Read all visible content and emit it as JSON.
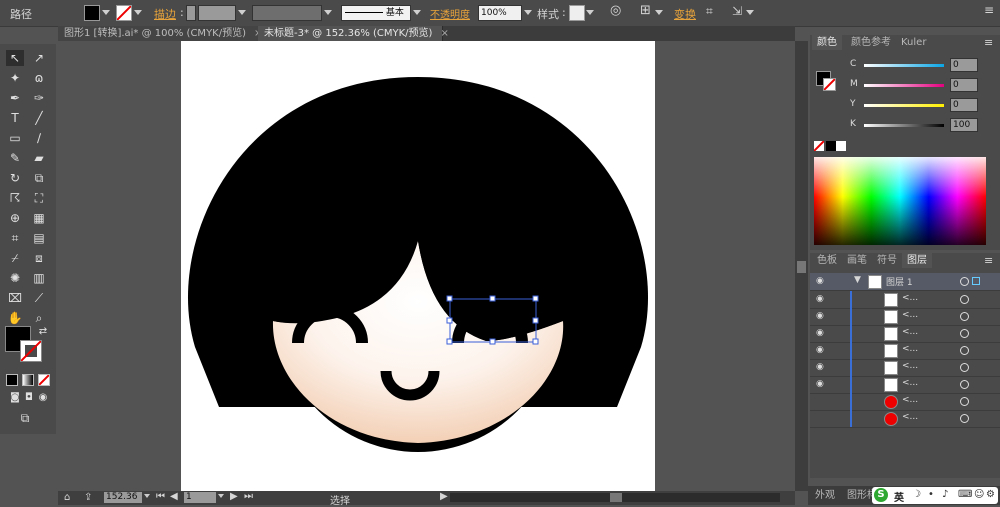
{
  "control_bar": {
    "selection_type": "路径",
    "stroke_label": "描边",
    "stroke_style": "基本",
    "opacity_label": "不透明度",
    "opacity_value": "100%",
    "style_label": "样式",
    "transform_label": "变换"
  },
  "tabs": [
    {
      "label": "图形1 [转换].ai* @ 100% (CMYK/预览)",
      "active": false
    },
    {
      "label": "未标题-3* @ 152.36% (CMYK/预览)",
      "active": true
    }
  ],
  "color_panel": {
    "tabs": [
      "颜色",
      "颜色参考",
      "Kuler"
    ],
    "sliders": [
      {
        "label": "C",
        "value": "0"
      },
      {
        "label": "M",
        "value": "0"
      },
      {
        "label": "Y",
        "value": "0"
      },
      {
        "label": "K",
        "value": "100"
      }
    ]
  },
  "layers_panel": {
    "tabs": [
      "色板",
      "画笔",
      "符号",
      "图层"
    ],
    "layer_name": "图层 1",
    "sublayer_label": "<...",
    "sublayer_count": 8
  },
  "status": {
    "zoom": "152.36",
    "artboard": "1",
    "tool": "选择"
  },
  "bottom_panel": {
    "tabs": [
      "外观",
      "图形样"
    ],
    "ime_label": "英"
  },
  "colors": {
    "hair": "#000000",
    "skin": "#fbe9dc",
    "selection": "#3a5fd8"
  }
}
